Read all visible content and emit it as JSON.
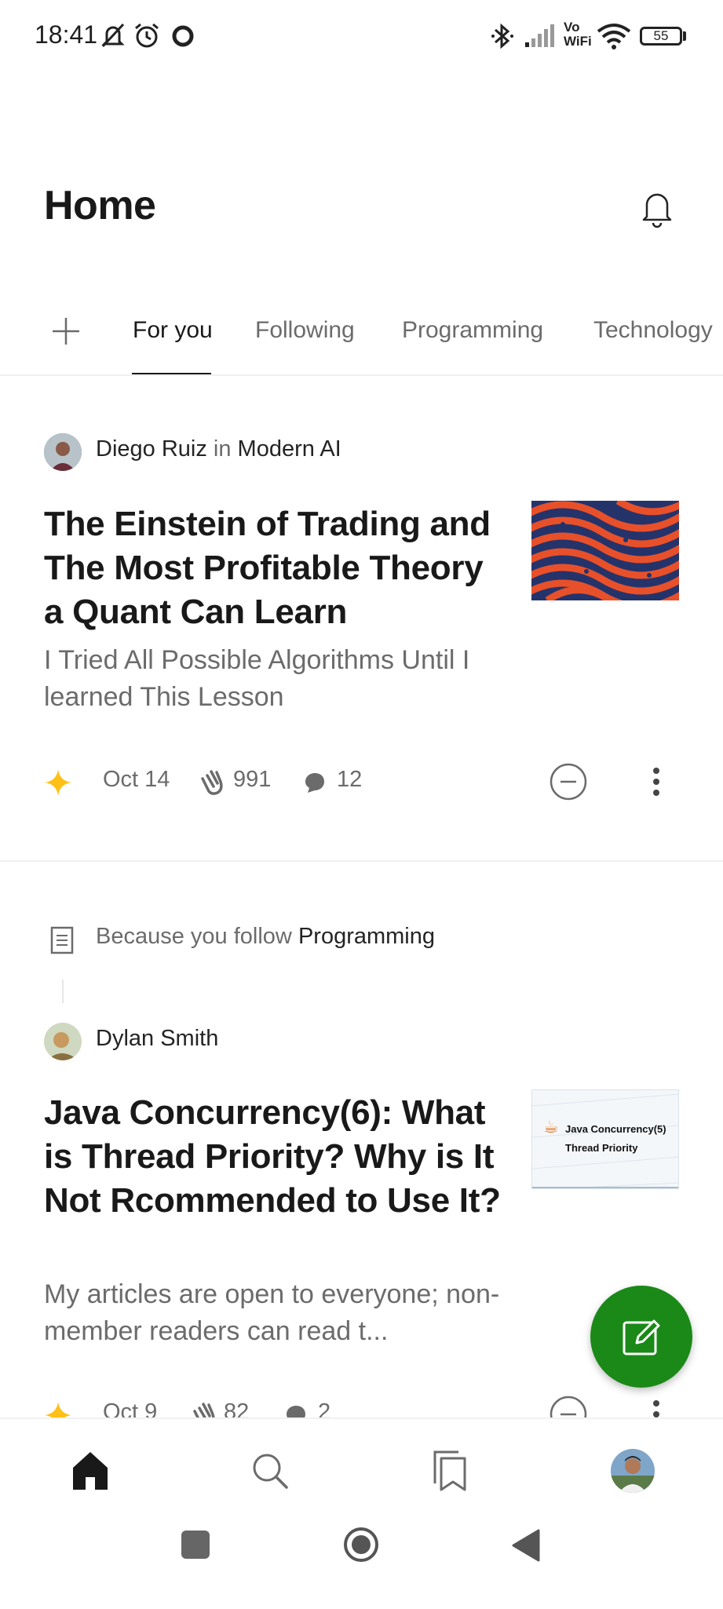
{
  "status_bar": {
    "time": "18:41",
    "battery": "55",
    "icons": [
      "mute-bell-icon",
      "alarm-icon",
      "circle-icon",
      "bluetooth-icon",
      "signal-icon",
      "vowifi-icon",
      "wifi-icon",
      "battery-icon"
    ],
    "vowifi_top": "Vo",
    "vowifi_bottom": "WiFi"
  },
  "header": {
    "title": "Home",
    "notification_icon": "bell-icon"
  },
  "tabs": {
    "add_icon": "plus-icon",
    "items": [
      {
        "label": "For you",
        "active": true
      },
      {
        "label": "Following",
        "active": false
      },
      {
        "label": "Programming",
        "active": false
      },
      {
        "label": "Technology",
        "active": false
      }
    ]
  },
  "articles": [
    {
      "author": "Diego Ruiz",
      "in_label": "in",
      "publication": "Modern AI",
      "title": "The Einstein of Trading and The Most Profitable Theory a Quant Can Learn",
      "subtitle": "I Tried All Possible Algorithms Until I learned This Lesson",
      "date": "Oct 14",
      "claps": "991",
      "comments": "12",
      "member_icon": "star-icon",
      "thumbnail_colors": [
        "#e8502a",
        "#25336b"
      ]
    },
    {
      "reason_prefix": "Because you follow",
      "reason_topic": "Programming",
      "author": "Dylan Smith",
      "title": "Java Concurrency(6): What is Thread Priority? Why is It Not Rcommended to Use It?",
      "subtitle": "My articles are open to everyone; non-member readers can read t...",
      "date": "Oct 9",
      "claps": "82",
      "comments": "2",
      "thumbnail_text_line1": "Java Concurrency(5)",
      "thumbnail_text_line2": "Thread Priority"
    }
  ],
  "fab": {
    "icon": "edit-icon",
    "color": "#1a8917"
  },
  "bottom_nav": {
    "items": [
      "home-icon",
      "search-icon",
      "bookmarks-icon",
      "profile-avatar"
    ]
  },
  "system_nav": [
    "recents-button",
    "home-button",
    "back-button"
  ]
}
